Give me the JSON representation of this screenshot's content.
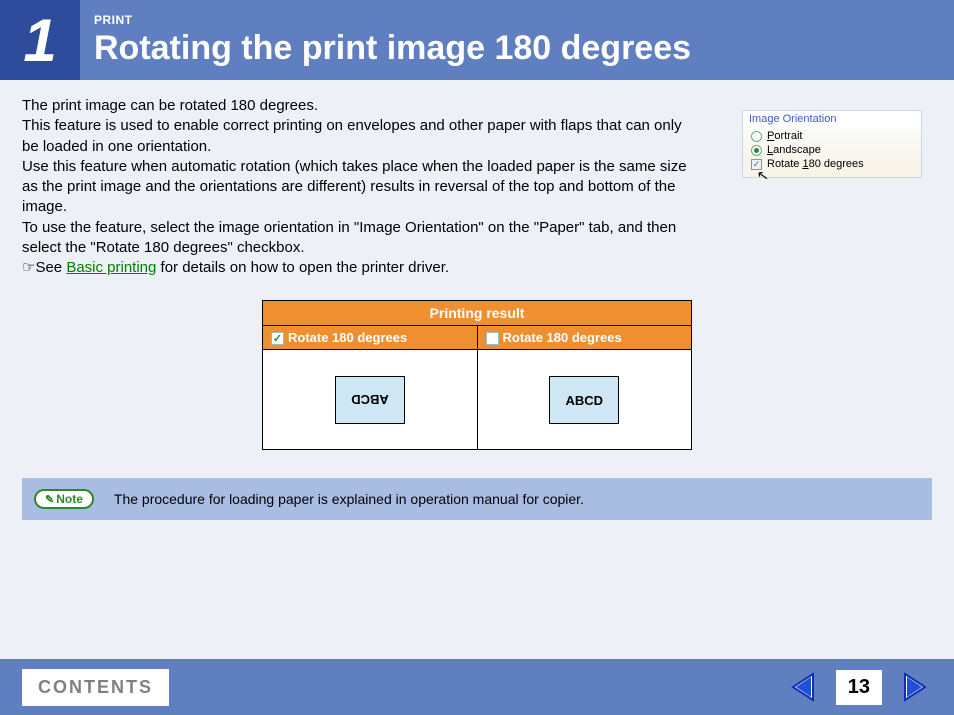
{
  "header": {
    "section_number": "1",
    "category": "PRINT",
    "title": "Rotating the print image 180 degrees"
  },
  "body": {
    "p1": "The print image can be rotated 180 degrees.",
    "p2": "This feature is used to enable correct printing on envelopes and other paper with flaps that can only be loaded in one orientation.",
    "p3": "Use this feature when automatic rotation (which takes place when the loaded paper is the same size as the print image and the orientations are different) results in reversal of the top and bottom of the image.",
    "p4": "To use the feature, select the image orientation in \"Image Orientation\" on the \"Paper\" tab, and then select the \"Rotate 180 degrees\" checkbox.",
    "see_prefix": "☞See ",
    "see_link": "Basic printing",
    "see_suffix": " for details on how to open the printer driver."
  },
  "orientation_panel": {
    "title": "Image Orientation",
    "opt_portrait_prefix": "P",
    "opt_portrait_rest": "ortrait",
    "opt_landscape_prefix": "L",
    "opt_landscape_rest": "andscape",
    "opt_rotate_pre": "Rotate ",
    "opt_rotate_u": "1",
    "opt_rotate_post": "80 degrees"
  },
  "result_table": {
    "header": "Printing result",
    "col_checked": "Rotate 180 degrees",
    "col_unchecked": "Rotate 180 degrees",
    "sample_text": "ABCD"
  },
  "note": {
    "badge": "Note",
    "text": "The procedure for loading paper is explained in operation manual for copier."
  },
  "footer": {
    "contents": "CONTENTS",
    "page_number": "13"
  }
}
